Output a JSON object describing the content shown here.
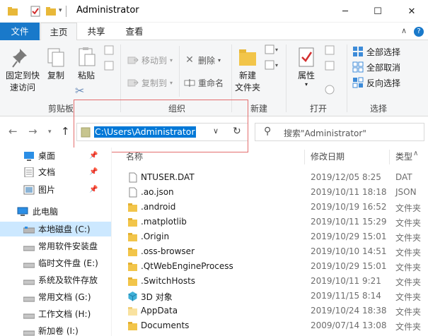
{
  "window": {
    "title": "Administrator",
    "minimize": "─",
    "maximize": "☐",
    "close": "✕"
  },
  "tabs": [
    "文件",
    "主页",
    "共享",
    "查看"
  ],
  "ribbon": {
    "clipboard": {
      "pin_label_1": "固定到快",
      "pin_label_2": "速访问",
      "copy": "复制",
      "paste": "粘贴",
      "group": "剪贴板"
    },
    "organize": {
      "move_to": "移动到",
      "copy_to": "复制到",
      "delete": "删除",
      "rename": "重命名",
      "group": "组织"
    },
    "new": {
      "new_folder_1": "新建",
      "new_folder_2": "文件夹",
      "group": "新建"
    },
    "open": {
      "properties": "属性",
      "group": "打开"
    },
    "select": {
      "select_all": "全部选择",
      "select_none": "全部取消",
      "invert": "反向选择",
      "group": "选择"
    }
  },
  "address": {
    "path": "C:\\Users\\Administrator",
    "search_placeholder": "搜索\"Administrator\""
  },
  "nav_pane": {
    "quick": [
      {
        "label": "桌面",
        "icon": "desktop-icon"
      },
      {
        "label": "文档",
        "icon": "documents-icon"
      },
      {
        "label": "图片",
        "icon": "pictures-icon"
      }
    ],
    "this_pc": "此电脑",
    "drives": [
      {
        "label": "本地磁盘 (C:)"
      },
      {
        "label": "常用软件安装盘"
      },
      {
        "label": "临时文件盘 (E:)"
      },
      {
        "label": "系统及软件存放"
      },
      {
        "label": "常用文档 (G:)"
      },
      {
        "label": "工作文档 (H:)"
      },
      {
        "label": "新加卷 (I:)"
      }
    ]
  },
  "columns": {
    "name": "名称",
    "date": "修改日期",
    "type": "类型"
  },
  "files": [
    {
      "name": "NTUSER.DAT",
      "date": "2019/12/05 8:25",
      "type": "DAT",
      "icon": "doc"
    },
    {
      "name": ".ao.json",
      "date": "2019/10/11 18:18",
      "type": "JSON",
      "icon": "doc"
    },
    {
      "name": ".android",
      "date": "2019/10/19 16:52",
      "type": "文件夹",
      "icon": "folder"
    },
    {
      "name": ".matplotlib",
      "date": "2019/10/11 15:29",
      "type": "文件夹",
      "icon": "folder"
    },
    {
      "name": ".Origin",
      "date": "2019/10/29 15:01",
      "type": "文件夹",
      "icon": "folder"
    },
    {
      "name": ".oss-browser",
      "date": "2019/10/10 14:51",
      "type": "文件夹",
      "icon": "folder"
    },
    {
      "name": ".QtWebEngineProcess",
      "date": "2019/10/29 15:01",
      "type": "文件夹",
      "icon": "folder"
    },
    {
      "name": ".SwitchHosts",
      "date": "2019/10/11 9:21",
      "type": "文件夹",
      "icon": "folder"
    },
    {
      "name": "3D 对象",
      "date": "2019/11/15 8:14",
      "type": "文件夹",
      "icon": "3d"
    },
    {
      "name": "AppData",
      "date": "2019/10/24 18:38",
      "type": "文件夹",
      "icon": "folder-light"
    },
    {
      "name": "Documents",
      "date": "2009/07/14 13:08",
      "type": "文件夹",
      "icon": "folder"
    }
  ]
}
